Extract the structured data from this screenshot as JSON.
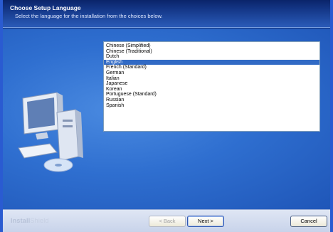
{
  "header": {
    "title": "Choose Setup Language",
    "subtitle": "Select the language for the installation from the choices below."
  },
  "languages": {
    "items": [
      "Chinese (Simplified)",
      "Chinese (Traditional)",
      "Dutch",
      "English",
      "French (Standard)",
      "German",
      "Italian",
      "Japanese",
      "Korean",
      "Portuguese (Standard)",
      "Russian",
      "Spanish"
    ],
    "selected": "English"
  },
  "footer": {
    "brand_main": "Install",
    "brand_sub": "Shield",
    "back_label": "< Back",
    "next_label": "Next >",
    "cancel_label": "Cancel"
  },
  "colors": {
    "header_bg": "#0a246a",
    "content_bg": "#2f6fd0",
    "selection": "#316ac5"
  }
}
